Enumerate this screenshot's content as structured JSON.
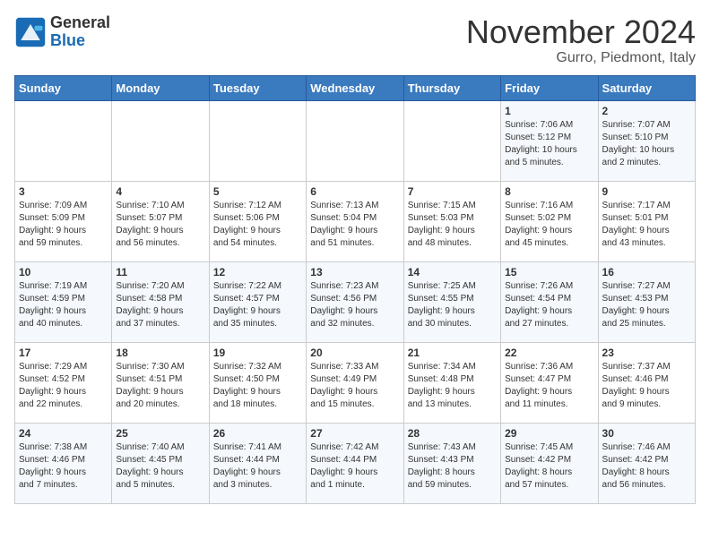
{
  "header": {
    "logo_general": "General",
    "logo_blue": "Blue",
    "title": "November 2024",
    "location": "Gurro, Piedmont, Italy"
  },
  "weekdays": [
    "Sunday",
    "Monday",
    "Tuesday",
    "Wednesday",
    "Thursday",
    "Friday",
    "Saturday"
  ],
  "weeks": [
    [
      {
        "day": "",
        "info": ""
      },
      {
        "day": "",
        "info": ""
      },
      {
        "day": "",
        "info": ""
      },
      {
        "day": "",
        "info": ""
      },
      {
        "day": "",
        "info": ""
      },
      {
        "day": "1",
        "info": "Sunrise: 7:06 AM\nSunset: 5:12 PM\nDaylight: 10 hours\nand 5 minutes."
      },
      {
        "day": "2",
        "info": "Sunrise: 7:07 AM\nSunset: 5:10 PM\nDaylight: 10 hours\nand 2 minutes."
      }
    ],
    [
      {
        "day": "3",
        "info": "Sunrise: 7:09 AM\nSunset: 5:09 PM\nDaylight: 9 hours\nand 59 minutes."
      },
      {
        "day": "4",
        "info": "Sunrise: 7:10 AM\nSunset: 5:07 PM\nDaylight: 9 hours\nand 56 minutes."
      },
      {
        "day": "5",
        "info": "Sunrise: 7:12 AM\nSunset: 5:06 PM\nDaylight: 9 hours\nand 54 minutes."
      },
      {
        "day": "6",
        "info": "Sunrise: 7:13 AM\nSunset: 5:04 PM\nDaylight: 9 hours\nand 51 minutes."
      },
      {
        "day": "7",
        "info": "Sunrise: 7:15 AM\nSunset: 5:03 PM\nDaylight: 9 hours\nand 48 minutes."
      },
      {
        "day": "8",
        "info": "Sunrise: 7:16 AM\nSunset: 5:02 PM\nDaylight: 9 hours\nand 45 minutes."
      },
      {
        "day": "9",
        "info": "Sunrise: 7:17 AM\nSunset: 5:01 PM\nDaylight: 9 hours\nand 43 minutes."
      }
    ],
    [
      {
        "day": "10",
        "info": "Sunrise: 7:19 AM\nSunset: 4:59 PM\nDaylight: 9 hours\nand 40 minutes."
      },
      {
        "day": "11",
        "info": "Sunrise: 7:20 AM\nSunset: 4:58 PM\nDaylight: 9 hours\nand 37 minutes."
      },
      {
        "day": "12",
        "info": "Sunrise: 7:22 AM\nSunset: 4:57 PM\nDaylight: 9 hours\nand 35 minutes."
      },
      {
        "day": "13",
        "info": "Sunrise: 7:23 AM\nSunset: 4:56 PM\nDaylight: 9 hours\nand 32 minutes."
      },
      {
        "day": "14",
        "info": "Sunrise: 7:25 AM\nSunset: 4:55 PM\nDaylight: 9 hours\nand 30 minutes."
      },
      {
        "day": "15",
        "info": "Sunrise: 7:26 AM\nSunset: 4:54 PM\nDaylight: 9 hours\nand 27 minutes."
      },
      {
        "day": "16",
        "info": "Sunrise: 7:27 AM\nSunset: 4:53 PM\nDaylight: 9 hours\nand 25 minutes."
      }
    ],
    [
      {
        "day": "17",
        "info": "Sunrise: 7:29 AM\nSunset: 4:52 PM\nDaylight: 9 hours\nand 22 minutes."
      },
      {
        "day": "18",
        "info": "Sunrise: 7:30 AM\nSunset: 4:51 PM\nDaylight: 9 hours\nand 20 minutes."
      },
      {
        "day": "19",
        "info": "Sunrise: 7:32 AM\nSunset: 4:50 PM\nDaylight: 9 hours\nand 18 minutes."
      },
      {
        "day": "20",
        "info": "Sunrise: 7:33 AM\nSunset: 4:49 PM\nDaylight: 9 hours\nand 15 minutes."
      },
      {
        "day": "21",
        "info": "Sunrise: 7:34 AM\nSunset: 4:48 PM\nDaylight: 9 hours\nand 13 minutes."
      },
      {
        "day": "22",
        "info": "Sunrise: 7:36 AM\nSunset: 4:47 PM\nDaylight: 9 hours\nand 11 minutes."
      },
      {
        "day": "23",
        "info": "Sunrise: 7:37 AM\nSunset: 4:46 PM\nDaylight: 9 hours\nand 9 minutes."
      }
    ],
    [
      {
        "day": "24",
        "info": "Sunrise: 7:38 AM\nSunset: 4:46 PM\nDaylight: 9 hours\nand 7 minutes."
      },
      {
        "day": "25",
        "info": "Sunrise: 7:40 AM\nSunset: 4:45 PM\nDaylight: 9 hours\nand 5 minutes."
      },
      {
        "day": "26",
        "info": "Sunrise: 7:41 AM\nSunset: 4:44 PM\nDaylight: 9 hours\nand 3 minutes."
      },
      {
        "day": "27",
        "info": "Sunrise: 7:42 AM\nSunset: 4:44 PM\nDaylight: 9 hours\nand 1 minute."
      },
      {
        "day": "28",
        "info": "Sunrise: 7:43 AM\nSunset: 4:43 PM\nDaylight: 8 hours\nand 59 minutes."
      },
      {
        "day": "29",
        "info": "Sunrise: 7:45 AM\nSunset: 4:42 PM\nDaylight: 8 hours\nand 57 minutes."
      },
      {
        "day": "30",
        "info": "Sunrise: 7:46 AM\nSunset: 4:42 PM\nDaylight: 8 hours\nand 56 minutes."
      }
    ]
  ]
}
